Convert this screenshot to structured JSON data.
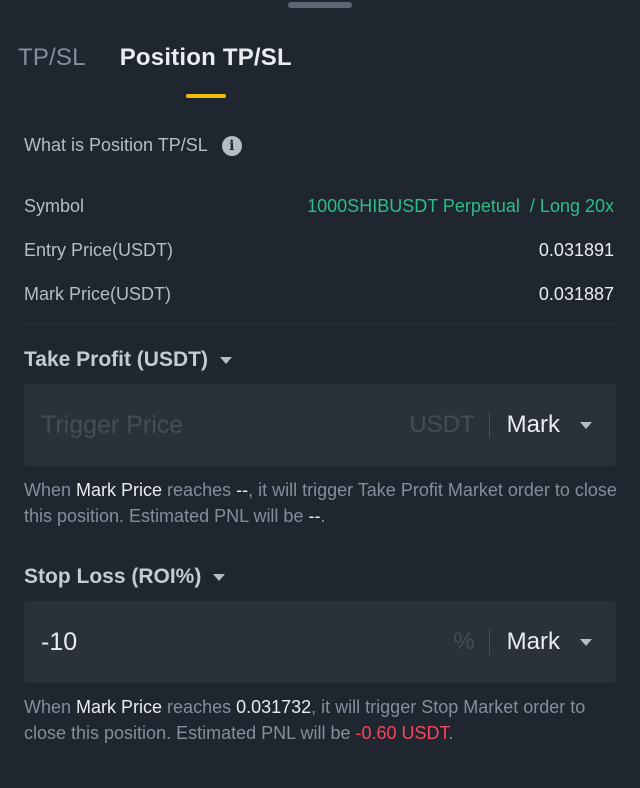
{
  "tabs": [
    {
      "label": "TP/SL",
      "active": false
    },
    {
      "label": "Position TP/SL",
      "active": true
    }
  ],
  "info": {
    "label": "What is Position TP/SL",
    "icon": "info-icon"
  },
  "details": {
    "symbol_label": "Symbol",
    "symbol_value": "1000SHIBUSDT Perpetual  / Long 20x",
    "entry_label": "Entry Price(USDT)",
    "entry_value": "0.031891",
    "mark_label": "Mark Price(USDT)",
    "mark_value": "0.031887"
  },
  "take_profit": {
    "title": "Take Profit (USDT)",
    "input_value": "",
    "placeholder": "Trigger Price",
    "unit": "USDT",
    "price_type": "Mark",
    "desc": {
      "p1": "When ",
      "mark_price": "Mark Price",
      "p2": " reaches ",
      "trigger": "--",
      "p3": ", it will trigger Take Profit Market order to close this position. Estimated PNL will be ",
      "pnl": "--",
      "p4": "."
    }
  },
  "stop_loss": {
    "title": "Stop Loss (ROI%)",
    "input_value": "-10",
    "placeholder": "",
    "unit": "%",
    "price_type": "Mark",
    "desc": {
      "p1": "When ",
      "mark_price": "Mark Price",
      "p2": " reaches ",
      "trigger": "0.031732",
      "p3": ", it will trigger Stop Market order to close this position. Estimated PNL will be ",
      "pnl": "-0.60 USDT",
      "p4": "."
    }
  },
  "colors": {
    "background": "#1f2630",
    "accent": "#f0b90b",
    "green": "#2ebd85",
    "red": "#f6465d"
  }
}
